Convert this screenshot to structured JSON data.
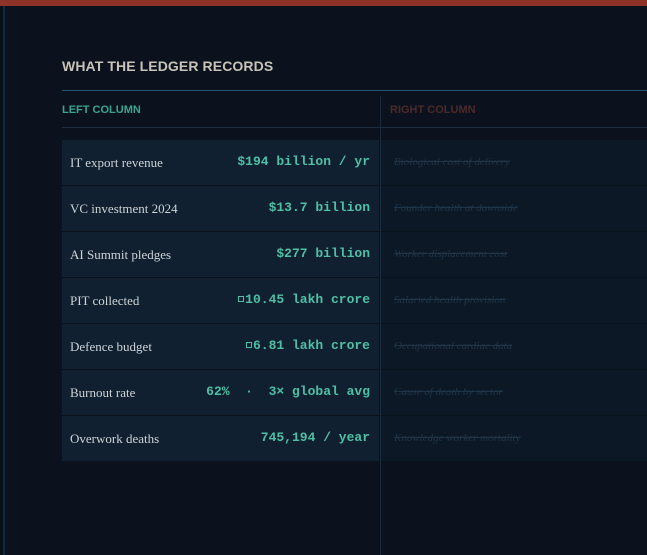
{
  "section_title": "WHAT THE LEDGER RECORDS",
  "columns": {
    "left_header": "LEFT COLUMN",
    "right_header": "RIGHT COLUMN"
  },
  "colors": {
    "accent_top_bar": "#8e3328",
    "left_value": "#4fbfa5",
    "left_header": "#3aa58f",
    "right_header": "#4b2a2a"
  },
  "rows": [
    {
      "label": "IT export revenue",
      "value": "$194 billion / yr",
      "right": "Biological cost of delivery"
    },
    {
      "label": "VC investment 2024",
      "value": "$13.7 billion",
      "right": "Founder health at downside"
    },
    {
      "label": "AI Summit pledges",
      "value": "$277 billion",
      "right": "Worker displacement cost"
    },
    {
      "label": "PIT collected",
      "value": "10.45 lakh crore",
      "value_icon": "rupee-glyph-icon",
      "right": "Salaried health provision"
    },
    {
      "label": "Defence budget",
      "value": "6.81 lakh crore",
      "value_icon": "rupee-glyph-icon",
      "right": "Occupational cardiac data"
    },
    {
      "label": "Burnout rate",
      "value": "62%  ·  3× global avg",
      "right": "Cause of death by sector"
    },
    {
      "label": "Overwork deaths",
      "value": "745,194 / year",
      "right": "Knowledge worker mortality"
    }
  ]
}
